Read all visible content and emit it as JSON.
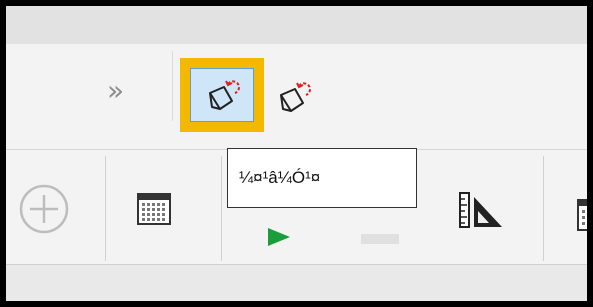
{
  "toolbar_top": {
    "overflow_chevron": "»",
    "erase_active_icon": "eraser-undo-icon",
    "erase_icon": "eraser-undo-icon"
  },
  "tooltip": {
    "text": "¼¤¹â¼Ó¹¤"
  },
  "toolbar_bottom": {
    "add_icon": "plus-circle-icon",
    "calendar_icon": "calendar-grid-icon",
    "play_icon": "green-arrow-icon",
    "ruler_icon": "ruler-triangle-icon"
  },
  "colors": {
    "highlight": "#f5b800",
    "active_bg": "#cfe6f8",
    "active_border": "#5b9fd6",
    "accent_red": "#e02020",
    "green": "#1a9e3a"
  }
}
